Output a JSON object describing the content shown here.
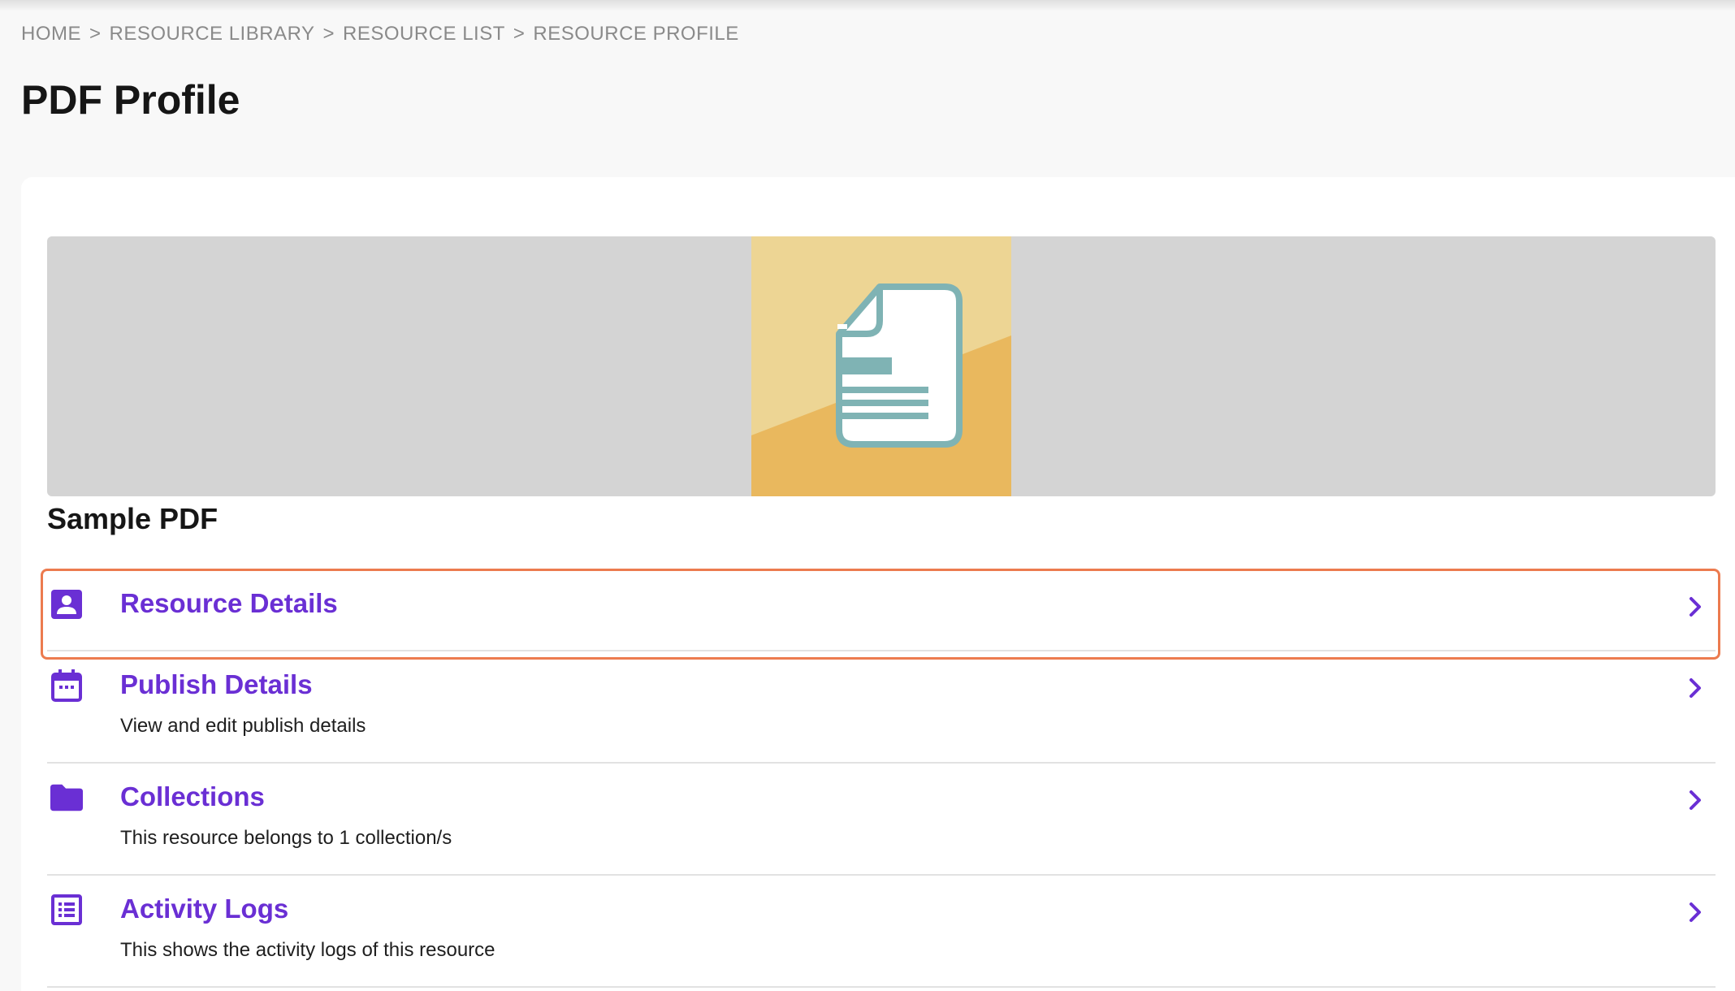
{
  "breadcrumb": {
    "items": [
      "HOME",
      "RESOURCE LIBRARY",
      "RESOURCE LIST",
      "RESOURCE PROFILE"
    ],
    "separator": ">"
  },
  "page": {
    "title": "PDF Profile"
  },
  "resource": {
    "name": "Sample PDF",
    "thumbnail_icon": "document-icon"
  },
  "menu": [
    {
      "label": "Resource Details",
      "description": "",
      "icon": "person-badge-icon"
    },
    {
      "label": "Publish Details",
      "description": "View and edit publish details",
      "icon": "calendar-icon"
    },
    {
      "label": "Collections",
      "description": "This resource belongs to 1 collection/s",
      "icon": "folder-icon"
    },
    {
      "label": "Activity Logs",
      "description": "This shows the activity logs of this resource",
      "icon": "list-icon"
    }
  ],
  "colors": {
    "accent": "#6a2fd4",
    "highlight": "#ec7b4f",
    "banner": "#d4d4d4",
    "thumb_light": "#edd594",
    "thumb_dark": "#e9b85e",
    "doc_teal": "#7fb3b4"
  }
}
